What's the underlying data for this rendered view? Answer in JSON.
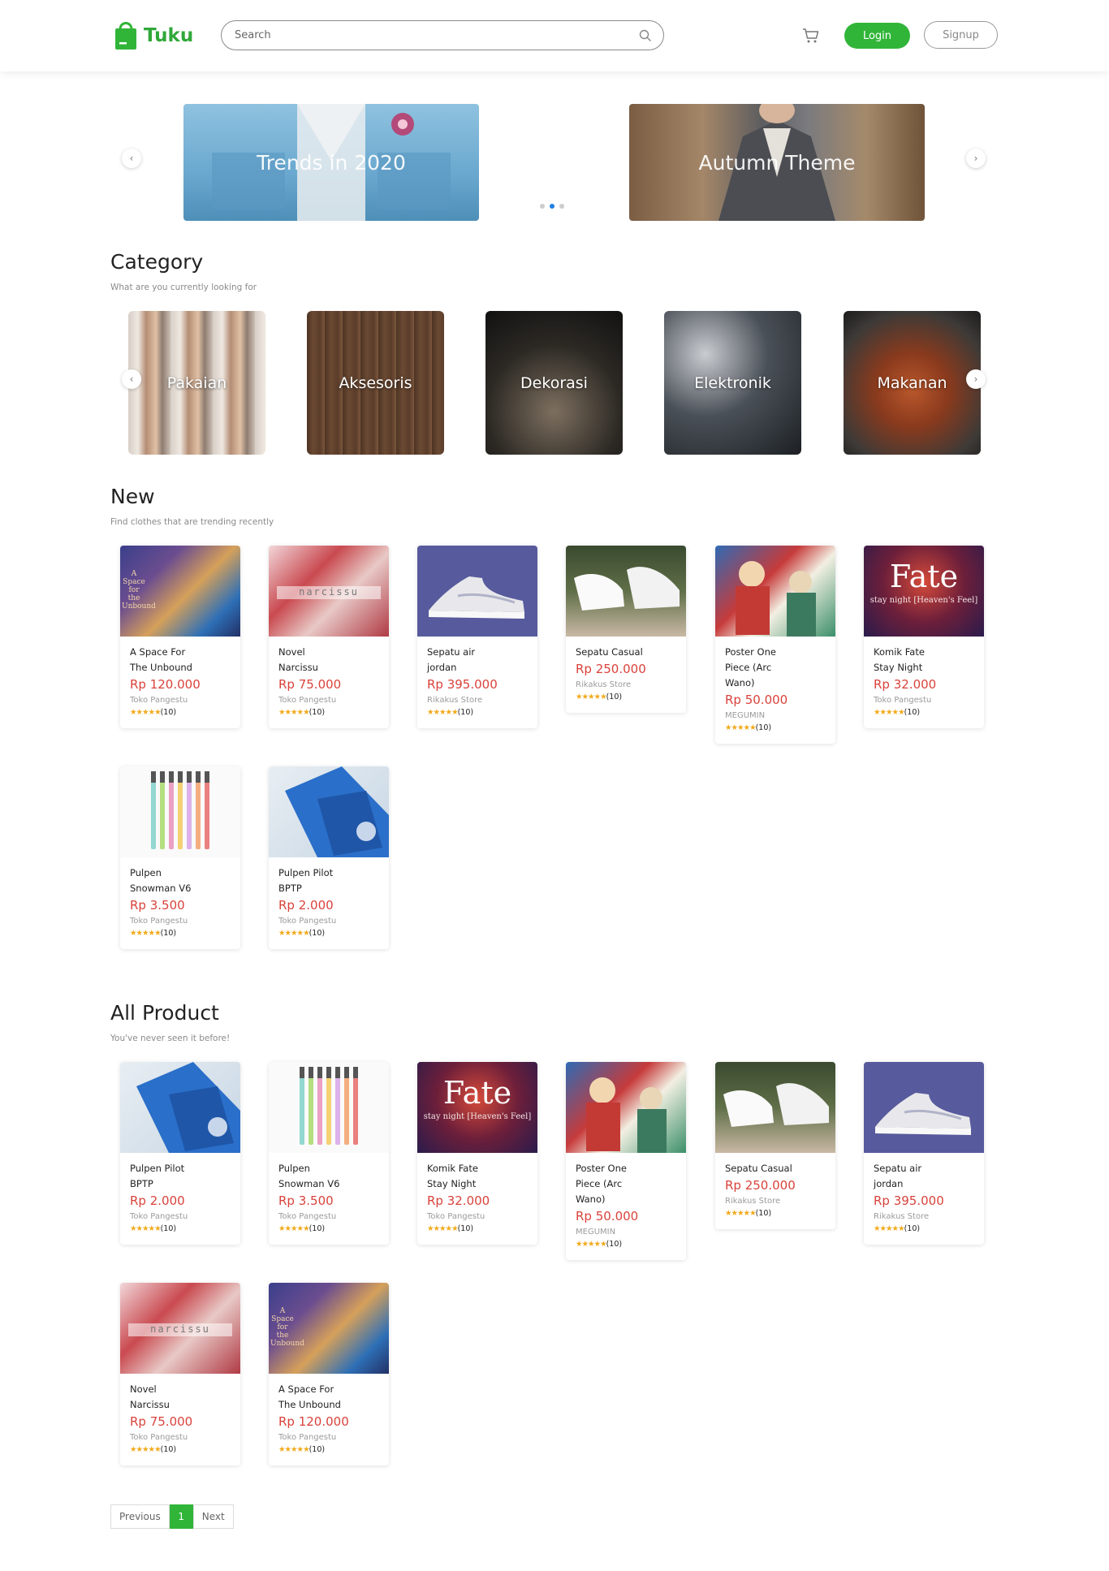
{
  "header": {
    "logo_text": "Tuku",
    "search_placeholder": "Search",
    "login_label": "Login",
    "signup_label": "Signup",
    "brand_color": "#31b539"
  },
  "carousel": {
    "slides": [
      {
        "title": "Trends in 2020"
      },
      {
        "title": "Autumn Theme"
      }
    ],
    "prev_icon": "‹",
    "next_icon": "›",
    "active_dot": 1,
    "dot_count": 3
  },
  "category": {
    "title": "Category",
    "subtitle": "What are you currently looking for",
    "items": [
      {
        "label": "Pakaian"
      },
      {
        "label": "Aksesoris"
      },
      {
        "label": "Dekorasi"
      },
      {
        "label": "Elektronik"
      },
      {
        "label": "Makanan"
      }
    ]
  },
  "new_section": {
    "title": "New",
    "subtitle": "Find clothes that are trending recently",
    "products": [
      {
        "name": "A Space For\nThe Unbound",
        "price": "Rp 120.000",
        "store": "Toko Pangestu",
        "rating": "(10)",
        "image": "anime-space"
      },
      {
        "name": "Novel\nNarcissu",
        "price": "Rp 75.000",
        "store": "Toko Pangestu",
        "rating": "(10)",
        "image": "anime-narcissu"
      },
      {
        "name": "Sepatu air\njordan",
        "price": "Rp 395.000",
        "store": "Rikakus Store",
        "rating": "(10)",
        "image": "shoe-jordan"
      },
      {
        "name": "Sepatu Casual",
        "price": "Rp 250.000",
        "store": "Rikakus Store",
        "rating": "(10)",
        "image": "shoe-casual"
      },
      {
        "name": "Poster One\nPiece (Arc\nWano)",
        "price": "Rp 50.000",
        "store": "MEGUMIN",
        "rating": "(10)",
        "image": "poster-onepiece"
      },
      {
        "name": "Komik Fate\nStay Night",
        "price": "Rp 32.000",
        "store": "Toko Pangestu",
        "rating": "(10)",
        "image": "comic-fate"
      },
      {
        "name": "Pulpen\nSnowman V6",
        "price": "Rp 3.500",
        "store": "Toko Pangestu",
        "rating": "(10)",
        "image": "pens-snowman"
      },
      {
        "name": "Pulpen Pilot\nBPTP",
        "price": "Rp 2.000",
        "store": "Toko Pangestu",
        "rating": "(10)",
        "image": "pens-pilot"
      }
    ]
  },
  "all_section": {
    "title": "All Product",
    "subtitle": "You've never seen it before!",
    "products": [
      {
        "name": "Pulpen Pilot\nBPTP",
        "price": "Rp 2.000",
        "store": "Toko Pangestu",
        "rating": "(10)",
        "image": "pens-pilot"
      },
      {
        "name": "Pulpen\nSnowman V6",
        "price": "Rp 3.500",
        "store": "Toko Pangestu",
        "rating": "(10)",
        "image": "pens-snowman"
      },
      {
        "name": "Komik Fate\nStay Night",
        "price": "Rp 32.000",
        "store": "Toko Pangestu",
        "rating": "(10)",
        "image": "comic-fate"
      },
      {
        "name": "Poster One\nPiece (Arc\nWano)",
        "price": "Rp 50.000",
        "store": "MEGUMIN",
        "rating": "(10)",
        "image": "poster-onepiece"
      },
      {
        "name": "Sepatu Casual",
        "price": "Rp 250.000",
        "store": "Rikakus Store",
        "rating": "(10)",
        "image": "shoe-casual"
      },
      {
        "name": "Sepatu air\njordan",
        "price": "Rp 395.000",
        "store": "Rikakus Store",
        "rating": "(10)",
        "image": "shoe-jordan"
      },
      {
        "name": "Novel\nNarcissu",
        "price": "Rp 75.000",
        "store": "Toko Pangestu",
        "rating": "(10)",
        "image": "anime-narcissu"
      },
      {
        "name": "A Space For\nThe Unbound",
        "price": "Rp 120.000",
        "store": "Toko Pangestu",
        "rating": "(10)",
        "image": "anime-space"
      }
    ]
  },
  "pagination": {
    "previous_label": "Previous",
    "current_page": "1",
    "next_label": "Next"
  },
  "product_image_texts": {
    "fate_title": "Fate",
    "fate_subtitle": "stay night [Heaven's Feel]",
    "narcissu": "narcissu",
    "space": "A Space for the Unbound"
  },
  "rating_stars": "★★★★★"
}
